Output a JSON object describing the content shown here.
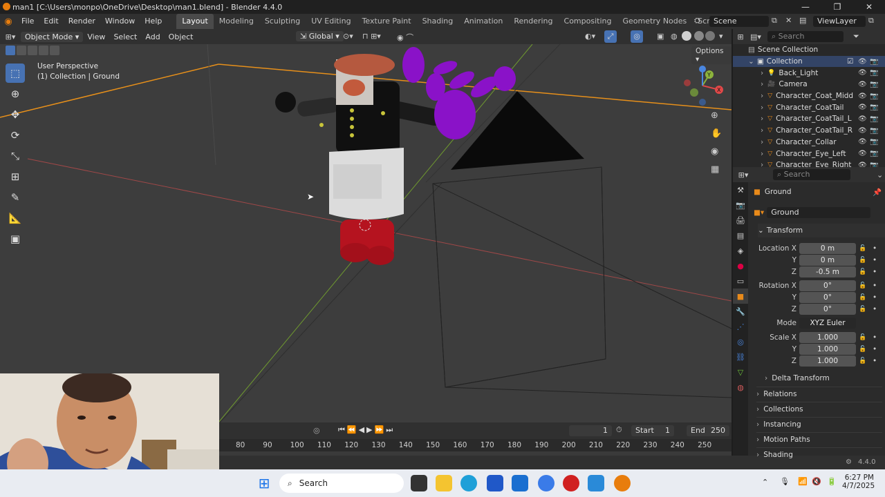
{
  "window": {
    "title": "man1 [C:\\Users\\monpo\\OneDrive\\Desktop\\man1.blend] - Blender 4.4.0",
    "controls": [
      "—",
      "❐",
      "✕"
    ]
  },
  "menu": [
    "File",
    "Edit",
    "Render",
    "Window",
    "Help"
  ],
  "workspaces": [
    "Layout",
    "Modeling",
    "Sculpting",
    "UV Editing",
    "Texture Paint",
    "Shading",
    "Animation",
    "Rendering",
    "Compositing",
    "Geometry Nodes",
    "Scripting"
  ],
  "active_workspace": "Layout",
  "scene": "Scene",
  "view_layer": "ViewLayer",
  "viewport_header": {
    "mode": "Object Mode",
    "menus": [
      "View",
      "Select",
      "Add",
      "Object"
    ],
    "orientation": "Global",
    "options": "Options"
  },
  "viewport": {
    "perspective": "User Perspective",
    "context": "(1) Collection | Ground"
  },
  "outliner": {
    "search_placeholder": "Search",
    "root": "Scene Collection",
    "collection": "Collection",
    "items": [
      "Back_Light",
      "Camera",
      "Character_Coat_Midd",
      "Character_CoatTail",
      "Character_CoatTail_L",
      "Character_CoatTail_R",
      "Character_Collar",
      "Character_Eye_Left",
      "Character_Eye_Right"
    ]
  },
  "properties": {
    "search_placeholder": "Search",
    "object_name": "Ground",
    "data_name": "Ground",
    "transform_label": "Transform",
    "location": {
      "label": "Location X",
      "x": "0 m",
      "y": "0 m",
      "z": "-0.5 m"
    },
    "rotation": {
      "label": "Rotation X",
      "x": "0°",
      "y": "0°",
      "z": "0°"
    },
    "mode_label": "Mode",
    "mode_value": "XYZ Euler",
    "scale": {
      "label": "Scale X",
      "x": "1.000",
      "y": "1.000",
      "z": "1.000"
    },
    "axis_y": "Y",
    "axis_z": "Z",
    "sections": [
      "Delta Transform",
      "Relations",
      "Collections",
      "Instancing",
      "Motion Paths",
      "Shading"
    ]
  },
  "timeline": {
    "current_frame": "1",
    "start_label": "Start",
    "start": "1",
    "end_label": "End",
    "end": "250",
    "ruler": [
      "80",
      "90",
      "100",
      "110",
      "120",
      "130",
      "140",
      "150",
      "160",
      "170",
      "180",
      "190",
      "200",
      "210",
      "220",
      "230",
      "240",
      "250"
    ]
  },
  "statusbar": {
    "version": "4.4.0"
  },
  "taskbar": {
    "search_placeholder": "Search",
    "time": "6:27 PM",
    "date": "4/7/2025"
  },
  "colors": {
    "accent": "#4772b3",
    "viewport_bg": "#3d3d3d",
    "purple": "#8a12c8",
    "orange_edge": "#e8901a"
  }
}
